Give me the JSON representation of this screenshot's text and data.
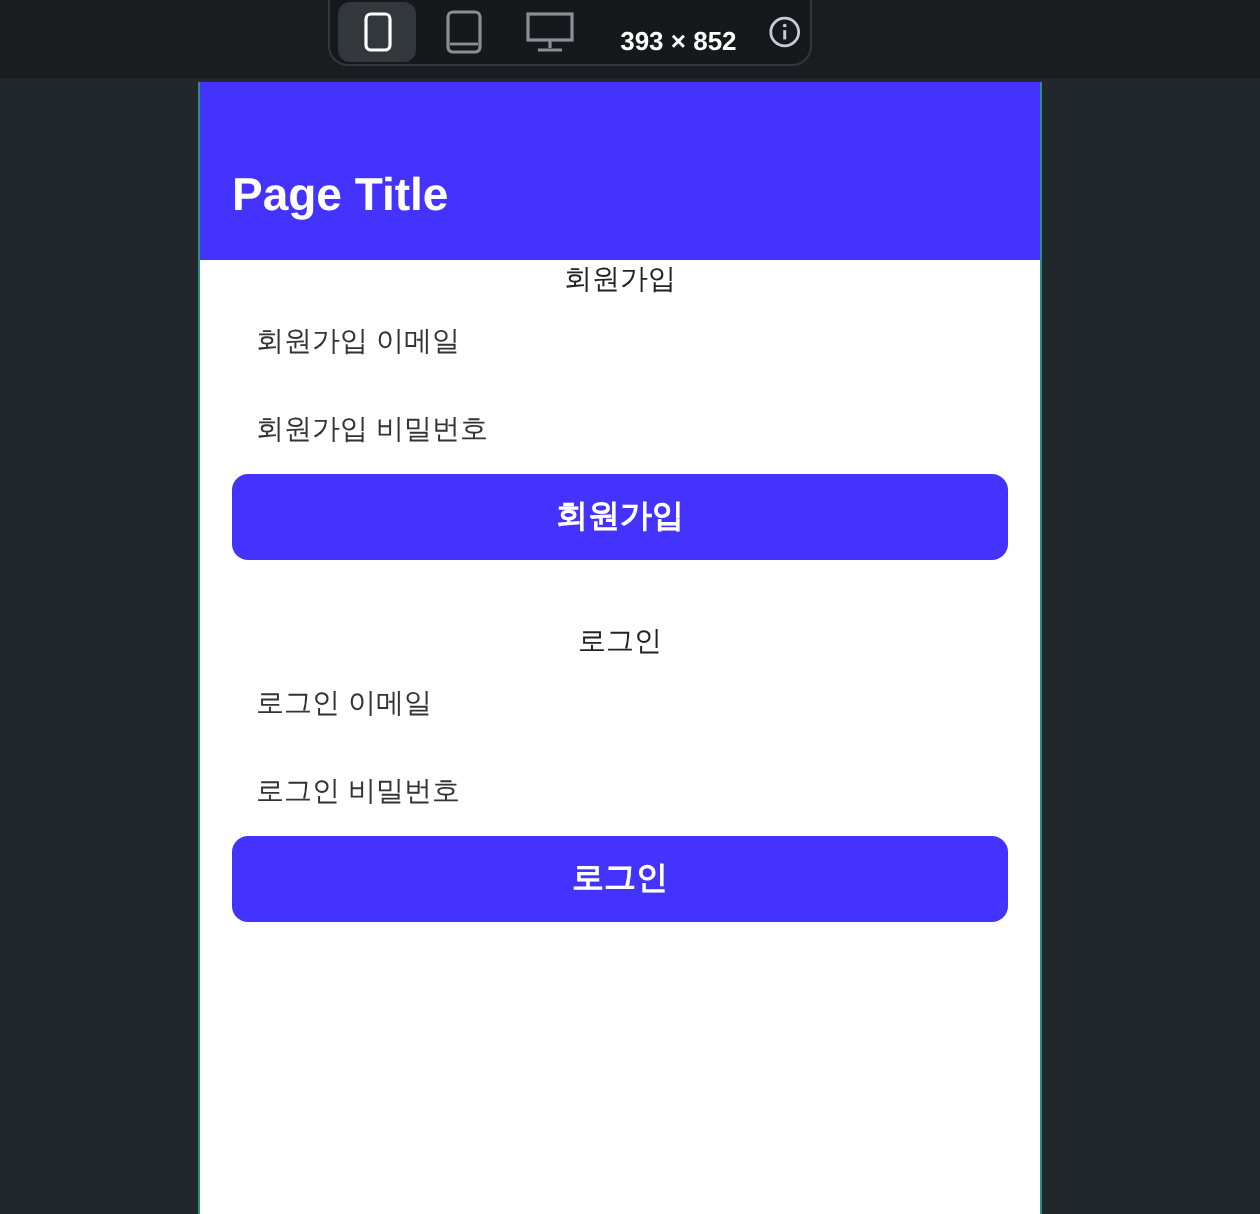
{
  "device_toolbar": {
    "devices": [
      {
        "kind": "phone",
        "selected": true
      },
      {
        "kind": "tablet",
        "selected": false
      },
      {
        "kind": "desktop",
        "selected": false
      }
    ],
    "size": "393 × 852"
  },
  "header": {
    "title": "Page Title"
  },
  "sections": [
    {
      "heading": "회원가입",
      "fields": [
        {
          "placeholder": "회원가입 이메일"
        },
        {
          "placeholder": "회원가입 비밀번호"
        }
      ],
      "button": "회원가입"
    },
    {
      "heading": "로그인",
      "fields": [
        {
          "placeholder": "로그인 이메일"
        },
        {
          "placeholder": "로그인 비밀번호"
        }
      ],
      "button": "로그인"
    }
  ]
}
